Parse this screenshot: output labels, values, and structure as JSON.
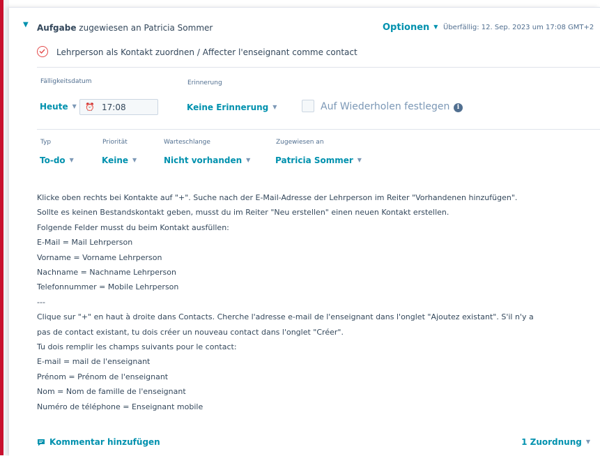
{
  "header": {
    "title_bold": "Aufgabe",
    "title_rest": " zugewiesen an Patricia Sommer",
    "options_label": "Optionen",
    "overdue_text": "Überfällig: 12. Sep. 2023 um 17:08 GMT+2"
  },
  "task": {
    "title": "Lehrperson als Kontakt zuordnen / Affecter l'enseignant comme contact",
    "completed": false
  },
  "schedule": {
    "due_label": "Fälligkeitsdatum",
    "due_value": "Heute",
    "time_value": "17:08",
    "reminder_label": "Erinnerung",
    "reminder_value": "Keine Erinnerung",
    "repeat_label": "Auf Wiederholen festlegen",
    "repeat_checked": false
  },
  "properties": {
    "type_label": "Typ",
    "type_value": "To-do",
    "priority_label": "Priorität",
    "priority_value": "Keine",
    "queue_label": "Warteschlange",
    "queue_value": "Nicht vorhanden",
    "assigned_label": "Zugewiesen an",
    "assigned_value": "Patricia Sommer"
  },
  "description": [
    "Klicke oben rechts bei Kontakte auf \"+\". Suche nach der E-Mail-Adresse der Lehrperson im Reiter \"Vorhandenen hinzufügen\".",
    "Sollte es keinen Bestandskontakt geben, musst du im Reiter \"Neu erstellen\" einen neuen Kontakt erstellen.",
    "Folgende Felder musst du beim Kontakt ausfüllen:",
    "E-Mail = Mail Lehrperson",
    "Vorname = Vorname Lehrperson",
    "Nachname = Nachname Lehrperson",
    "Telefonnummer = Mobile Lehrperson",
    "---",
    "Clique sur \"+\" en haut à droite dans Contacts. Cherche l'adresse e-mail de l'enseignant dans l'onglet \"Ajoutez existant\". S'il n'y a",
    "pas de contact existant, tu dois créer un nouveau contact dans l'onglet \"Créer\".",
    "Tu dois remplir les champs suivants pour le contact:",
    "E-mail = mail de l'enseignant",
    "Prénom = Prénom de l'enseignant",
    "Nom = Nom de famille de l'enseignant",
    "Numéro de téléphone = Enseignant mobile"
  ],
  "footer": {
    "comment_label": "Kommentar hinzufügen",
    "association_label": "1 Zuordnung"
  },
  "icons": {
    "collapse": "chevron-down-icon",
    "complete": "check-circle-icon",
    "alarm": "alarm-clock-icon",
    "info": "info-icon",
    "comment": "comment-icon"
  },
  "colors": {
    "accent": "#0091ae",
    "text": "#33475b",
    "muted": "#516f90",
    "incomplete_ring": "#e34a4a",
    "frame": "#c8102e"
  }
}
